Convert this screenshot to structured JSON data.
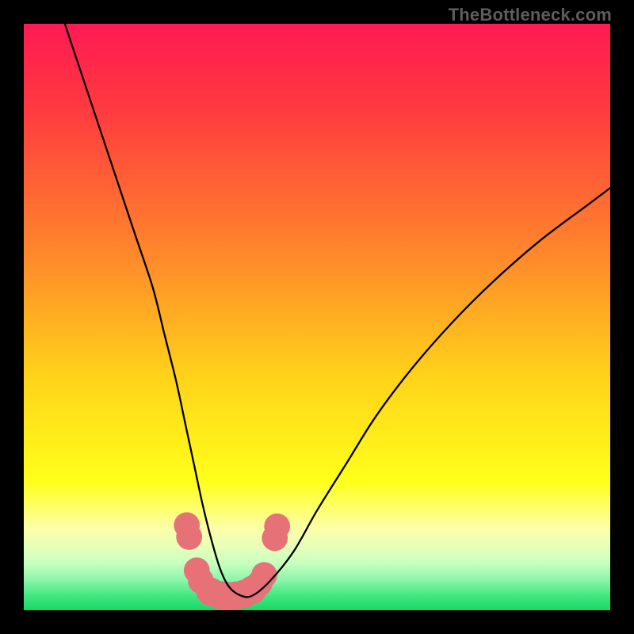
{
  "watermark": "TheBottleneck.com",
  "chart_data": {
    "type": "line",
    "title": "",
    "xlabel": "",
    "ylabel": "",
    "xlim": [
      0,
      100
    ],
    "ylim": [
      0,
      100
    ],
    "gradient_stops": [
      {
        "offset": 0.0,
        "color": "#ff1a54"
      },
      {
        "offset": 0.15,
        "color": "#ff3b3f"
      },
      {
        "offset": 0.4,
        "color": "#ff8a2a"
      },
      {
        "offset": 0.6,
        "color": "#ffd21a"
      },
      {
        "offset": 0.78,
        "color": "#ffff1a"
      },
      {
        "offset": 0.86,
        "color": "#fdffa8"
      },
      {
        "offset": 0.89,
        "color": "#e8ffb8"
      },
      {
        "offset": 0.92,
        "color": "#c8ffc0"
      },
      {
        "offset": 0.95,
        "color": "#88f5a8"
      },
      {
        "offset": 0.975,
        "color": "#40e880"
      },
      {
        "offset": 1.0,
        "color": "#18d868"
      }
    ],
    "series": [
      {
        "name": "bottleneck-curve",
        "color": "#000000",
        "stroke_width": 2.3,
        "x": [
          7,
          10,
          13,
          16,
          19,
          22,
          24,
          26,
          27.5,
          29,
          30.5,
          32,
          33.5,
          35,
          37,
          39,
          42,
          46,
          50,
          55,
          60,
          66,
          73,
          80,
          88,
          96,
          100
        ],
        "values": [
          100,
          91,
          82,
          73,
          64,
          55,
          47,
          39,
          32,
          25,
          18,
          12,
          7,
          4,
          2.5,
          2.5,
          5,
          10,
          17,
          25,
          33,
          41,
          49,
          56,
          63,
          69,
          72
        ]
      }
    ],
    "points": [
      {
        "x": 27.8,
        "y": 14.5,
        "r": 1.4
      },
      {
        "x": 28.2,
        "y": 12.5,
        "r": 1.4
      },
      {
        "x": 29.5,
        "y": 6.8,
        "r": 1.4
      },
      {
        "x": 30.2,
        "y": 5.0,
        "r": 1.4
      },
      {
        "x": 31.8,
        "y": 3.2,
        "r": 1.6
      },
      {
        "x": 33.3,
        "y": 2.6,
        "r": 1.6
      },
      {
        "x": 34.8,
        "y": 2.4,
        "r": 1.6
      },
      {
        "x": 36.2,
        "y": 2.5,
        "r": 1.6
      },
      {
        "x": 37.6,
        "y": 2.8,
        "r": 1.6
      },
      {
        "x": 39.0,
        "y": 3.5,
        "r": 1.6
      },
      {
        "x": 40.2,
        "y": 4.6,
        "r": 1.4
      },
      {
        "x": 41.0,
        "y": 6.0,
        "r": 1.4
      },
      {
        "x": 42.8,
        "y": 12.3,
        "r": 1.4
      },
      {
        "x": 43.2,
        "y": 14.3,
        "r": 1.4
      }
    ],
    "point_color": "#e67277"
  }
}
